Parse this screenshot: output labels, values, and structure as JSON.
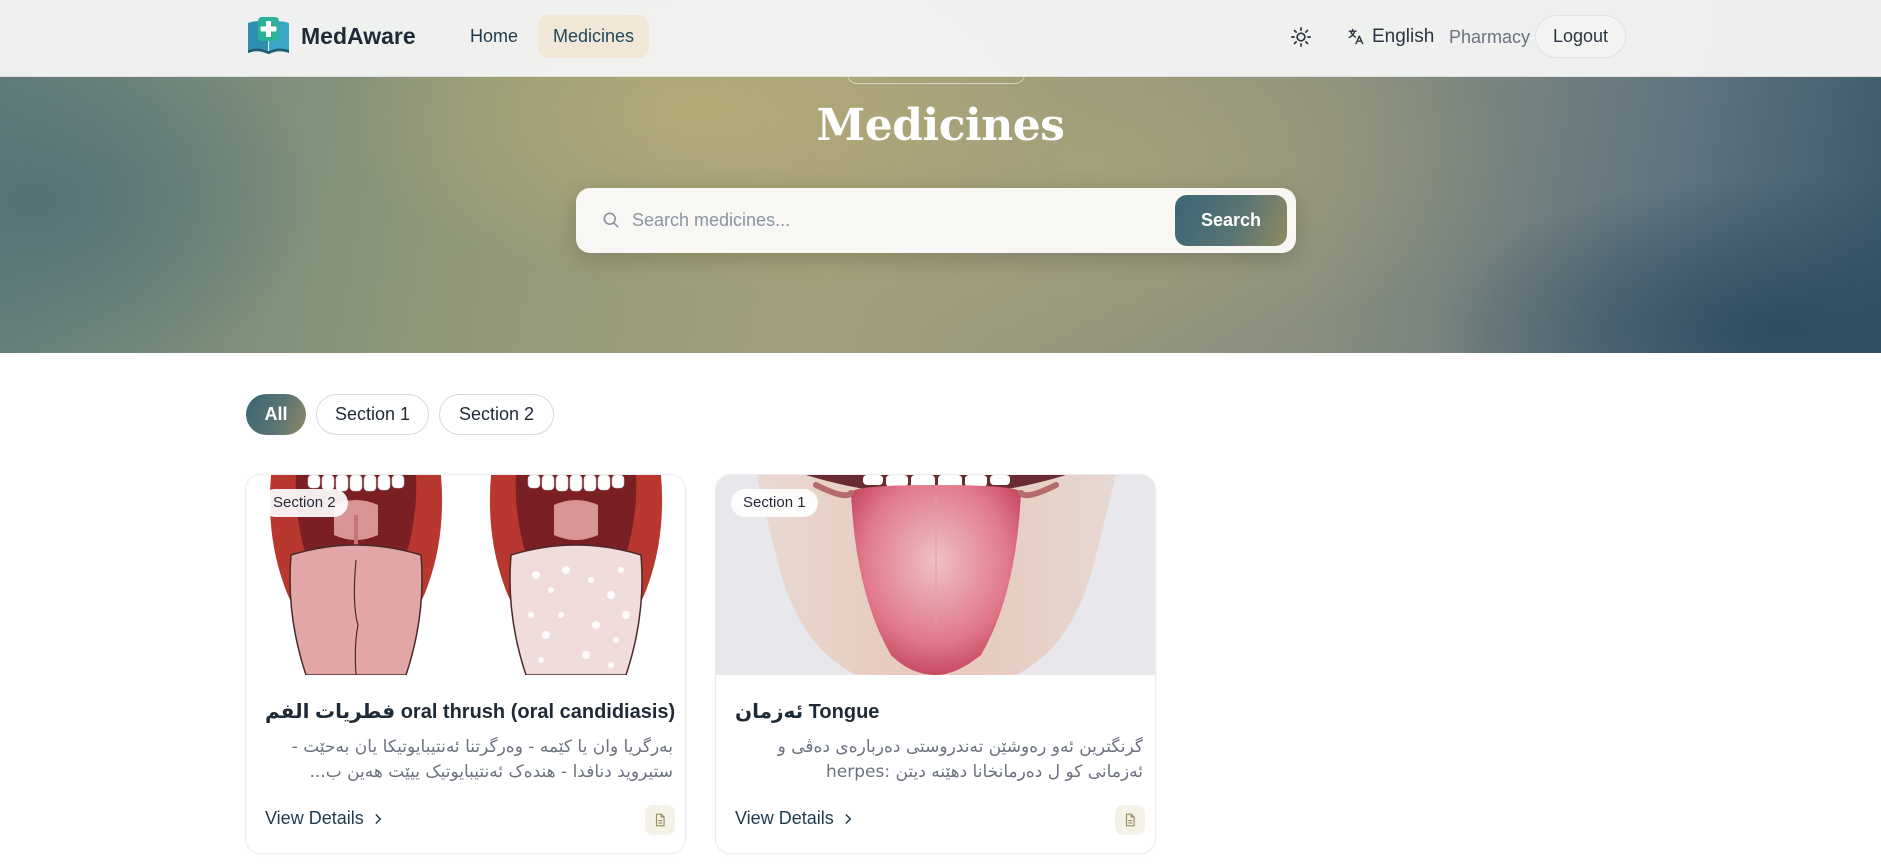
{
  "navbar": {
    "brand": "MedAware",
    "links": [
      {
        "label": "Home",
        "active": false
      },
      {
        "label": "Medicines",
        "active": true
      }
    ],
    "theme_icon": "sun-icon",
    "language": "English",
    "pharmacy": "Pharmacy",
    "logout": "Logout"
  },
  "hero": {
    "title": "Medicines",
    "search": {
      "placeholder": "Search medicines...",
      "value": "",
      "button_label": "Search"
    }
  },
  "filters": {
    "items": [
      "All",
      "Section 1",
      "Section 2"
    ],
    "selected": "All"
  },
  "cards": [
    {
      "badge": "Section 2",
      "title": "فطريات الفم oral thrush (oral candidiasis)",
      "description": "بەرگریا وان یا کێمە - وەرگرتنا ئەنتیبایوتیکا یان بەحێت - ستیروید دنافدا - هندەک ئەنتیبایوتیک ییێت هەین ب...",
      "link_label": "View Details",
      "image": "illustration-healthy-and-thrush-tongue"
    },
    {
      "badge": "Section 1",
      "title": "ئەزمان Tongue",
      "description": "گرنگترین ئەو رەوشێن تەندروستی دەربارەی دەڤی و ئەزمانی کو ل دەرمانخانا دهێنە دیتن :herpes simplex-...",
      "link_label": "View Details",
      "image": "photo-tongue-out"
    }
  ],
  "colors": {
    "accent_gradient_start": "#3a6575",
    "accent_gradient_end": "#8e8a62",
    "active_nav_bg": "#f2e6d7",
    "text_dark": "#1f2a37",
    "text_muted": "#6b7280"
  }
}
